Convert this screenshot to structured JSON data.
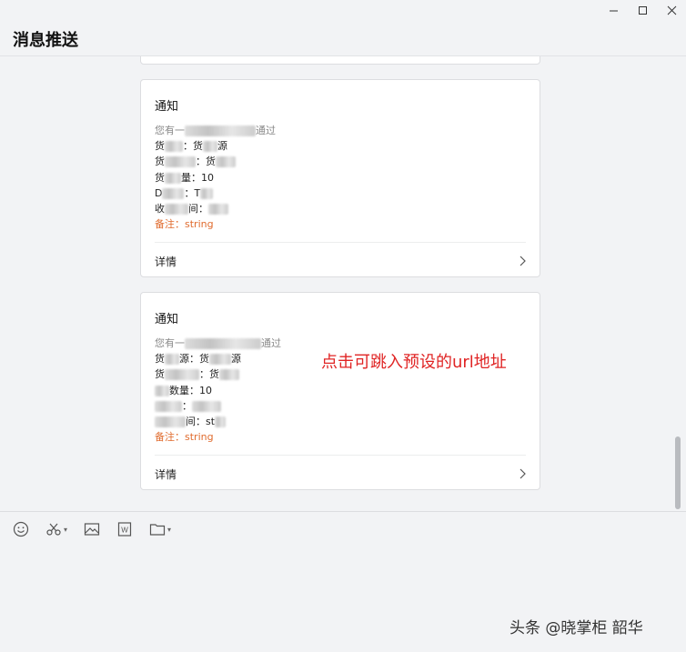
{
  "window": {
    "minimize_label": "—",
    "maximize_label": "☐",
    "close_label": "✕"
  },
  "header": {
    "title": "消息推送"
  },
  "cards": [
    {
      "title": "通知",
      "lines": {
        "l1a": "您有一",
        "l1b": "通过",
        "l2a": "货",
        "l2b": "：货",
        "l2c": "源",
        "l3a": "货",
        "l3b": "：货",
        "l4a": "货",
        "l4b": "量：10",
        "l5a": "D",
        "l5b": "：T",
        "l6a": "收",
        "l6b": "间：",
        "remark": "备注：string"
      },
      "footer_label": "详情"
    },
    {
      "title": "通知",
      "lines": {
        "l1a": "您有一",
        "l1b": "通过",
        "l2a": "货",
        "l2b": "源：货",
        "l2c": "源",
        "l3a": "货",
        "l3b": "：货",
        "l4a": "",
        "l4b": "数量：10",
        "l5a": "",
        "l5b": "：",
        "l6a": "",
        "l6b": "间：st",
        "remark": "备注：string"
      },
      "footer_label": "详情"
    }
  ],
  "annotation": "点击可跳入预设的url地址",
  "toolbar": {
    "icons": [
      "emoji-icon",
      "scissors-icon",
      "image-icon",
      "word-doc-icon",
      "folder-icon"
    ]
  },
  "watermark": "头条 @晓掌柜 韶华",
  "colors": {
    "background": "#f2f3f5",
    "card": "#ffffff",
    "remark": "#e06c2f",
    "annotation": "#e02424"
  }
}
